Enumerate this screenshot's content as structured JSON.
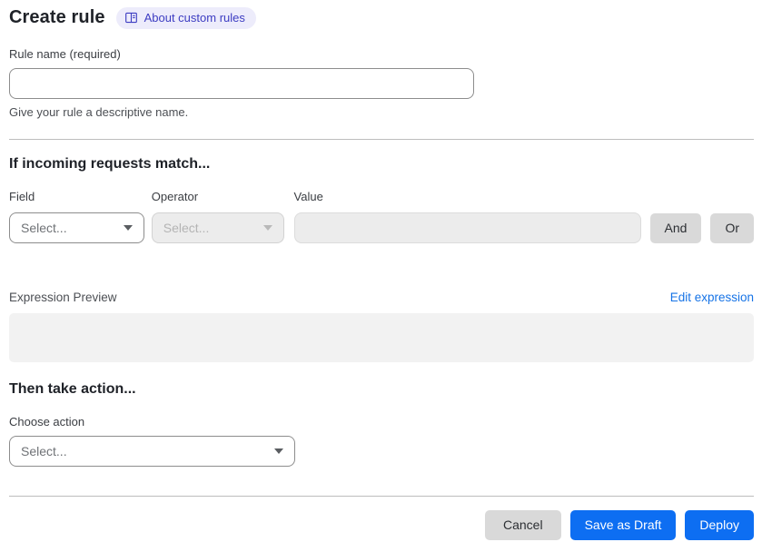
{
  "header": {
    "title": "Create rule",
    "about_badge": "About custom rules"
  },
  "rule_name": {
    "label": "Rule name (required)",
    "value": "",
    "helper": "Give your rule a descriptive name."
  },
  "match": {
    "heading": "If incoming requests match...",
    "field_label": "Field",
    "field_value": "Select...",
    "operator_label": "Operator",
    "operator_value": "Select...",
    "value_label": "Value",
    "value_value": "",
    "and_label": "And",
    "or_label": "Or"
  },
  "expression": {
    "label": "Expression Preview",
    "edit_link": "Edit expression",
    "value": ""
  },
  "action": {
    "heading": "Then take action...",
    "label": "Choose action",
    "value": "Select..."
  },
  "footer": {
    "cancel_label": "Cancel",
    "save_draft_label": "Save as Draft",
    "deploy_label": "Deploy"
  },
  "colors": {
    "primary_blue": "#0d6ef2",
    "link_blue": "#1673e6",
    "badge_bg": "#edecfb",
    "badge_text": "#3d3dc2",
    "gray_button_bg": "#d9d9d9",
    "disabled_bg": "#ececec",
    "expression_box_bg": "#f2f2f2",
    "divider": "#bdbdbd"
  }
}
